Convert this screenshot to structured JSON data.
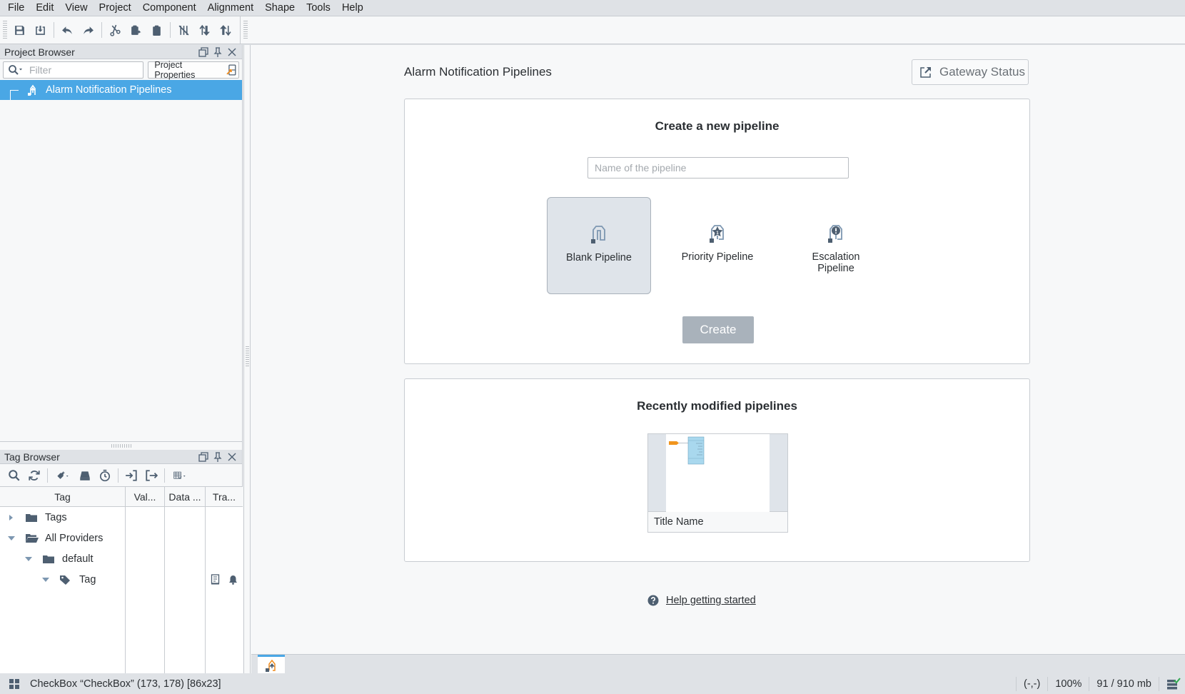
{
  "menu": [
    "File",
    "Edit",
    "View",
    "Project",
    "Component",
    "Alignment",
    "Shape",
    "Tools",
    "Help"
  ],
  "toolbar": {
    "buttons": [
      "save",
      "save-as",
      "undo",
      "redo",
      "cut",
      "paste-special",
      "paste",
      "disable-layout",
      "move-forward",
      "move-backward"
    ]
  },
  "project_browser": {
    "title": "Project Browser",
    "filter_placeholder": "Filter",
    "properties_label": "Project Properties",
    "tree": [
      {
        "label": "Alarm Notification Pipelines",
        "selected": true
      }
    ]
  },
  "tag_browser": {
    "title": "Tag Browser",
    "columns": [
      "Tag",
      "Val...",
      "Data ...",
      "Tra..."
    ],
    "rows": [
      {
        "label": "Tags",
        "expanded": false,
        "level": 0,
        "icon": "folder-icon"
      },
      {
        "label": "All Providers",
        "expanded": true,
        "level": 0,
        "icon": "folder-open-icon"
      },
      {
        "label": "default",
        "expanded": true,
        "level": 1,
        "icon": "folder-icon"
      },
      {
        "label": "Tag",
        "expanded": true,
        "level": 2,
        "icon": "tag-icon"
      }
    ]
  },
  "main": {
    "title": "Alarm Notification Pipelines",
    "gateway_button": "Gateway Status",
    "create": {
      "title": "Create a new pipeline",
      "name_placeholder": "Name of the pipeline",
      "name_value": "",
      "templates": [
        {
          "label": "Blank Pipeline",
          "selected": true
        },
        {
          "label": "Priority Pipeline",
          "selected": false
        },
        {
          "label": "Escalation Pipeline",
          "selected": false
        }
      ],
      "create_button": "Create"
    },
    "recent": {
      "title": "Recently modified pipelines",
      "items": [
        {
          "label": "Title Name"
        }
      ]
    },
    "help_link": "Help getting started"
  },
  "status": {
    "component": "CheckBox “CheckBox”  (173, 178) [86x23]",
    "cursor": "(-,-)",
    "zoom": "100%",
    "memory": "91 / 910 mb"
  },
  "colors": {
    "selection": "#4aa7e5",
    "icon": "#4e5f71",
    "accent_orange": "#f08c1e",
    "disabled_button": "#a9b2bb"
  }
}
